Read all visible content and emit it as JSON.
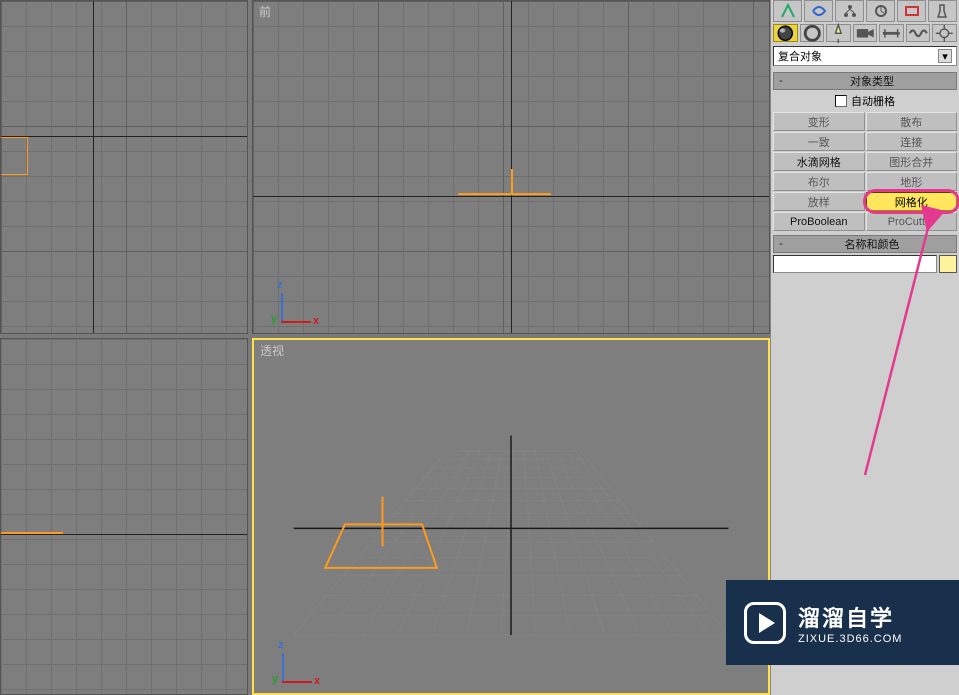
{
  "viewports": {
    "top_label": "",
    "front_label": "前",
    "left_label": "",
    "persp_label": "透视"
  },
  "axes": {
    "x": "x",
    "z": "z",
    "y": "y"
  },
  "panel": {
    "dropdown": "复合对象",
    "rollout_type": "对象类型",
    "rollout_name": "名称和颜色",
    "collapse": "-",
    "autogrid": "自动栅格",
    "buttons": {
      "morph": "变形",
      "scatter": "散布",
      "conform": "一致",
      "connect": "连接",
      "blobmesh": "水滴网格",
      "shapemerge": "图形合并",
      "boolean": "布尔",
      "terrain": "地形",
      "loft": "放样",
      "mesher": "网格化",
      "proboolean": "ProBoolean",
      "procutter": "ProCutter"
    },
    "name_value": "",
    "swatch_color": "#fff3a0"
  },
  "watermark": {
    "title": "溜溜自学",
    "sub": "ZIXUE.3D66.COM"
  }
}
